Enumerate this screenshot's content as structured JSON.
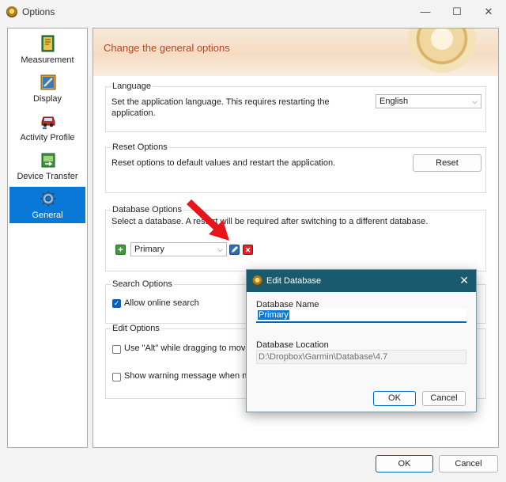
{
  "window": {
    "title": "Options",
    "minimize": "—",
    "maximize": "☐",
    "close": "✕"
  },
  "sidebar": {
    "items": [
      {
        "label": "Measurement",
        "icon": "measurement-book-icon",
        "active": false
      },
      {
        "label": "Display",
        "icon": "display-paint-icon",
        "active": false
      },
      {
        "label": "Activity Profile",
        "icon": "activity-car-icon",
        "active": false
      },
      {
        "label": "Device Transfer",
        "icon": "device-transfer-icon",
        "active": false
      },
      {
        "label": "General",
        "icon": "general-gear-icon",
        "active": true
      }
    ]
  },
  "banner": {
    "title": "Change the general options"
  },
  "language": {
    "title": "Language",
    "description_line1": "Set the application language. This requires restarting the",
    "description_line2": "application.",
    "selected": "English"
  },
  "reset": {
    "title": "Reset Options",
    "description": "Reset options to default values and restart the application.",
    "button": "Reset"
  },
  "database": {
    "title": "Database Options",
    "description": "Select a database.  A restart will be required after switching to a different database.",
    "selected": "Primary",
    "add_icon": "+",
    "delete_icon": "✕"
  },
  "search": {
    "title": "Search Options",
    "allow_online": "Allow online search",
    "allow_online_checked": true
  },
  "edit": {
    "title": "Edit Options",
    "alt_drag": "Use \"Alt\" while dragging to move",
    "warning": "Show warning message when no"
  },
  "dialog": {
    "title": "Edit Database",
    "name_label": "Database Name",
    "name_value": "Primary",
    "location_label": "Database Location",
    "location_value": "D:\\Dropbox\\Garmin\\Database\\4.7",
    "ok": "OK",
    "cancel": "Cancel"
  },
  "footer": {
    "ok": "OK",
    "cancel": "Cancel"
  },
  "colors": {
    "accent": "#0a78d7",
    "dialog_title": "#195a6e",
    "banner_text": "#b2471e",
    "arrow": "#e8141b"
  }
}
